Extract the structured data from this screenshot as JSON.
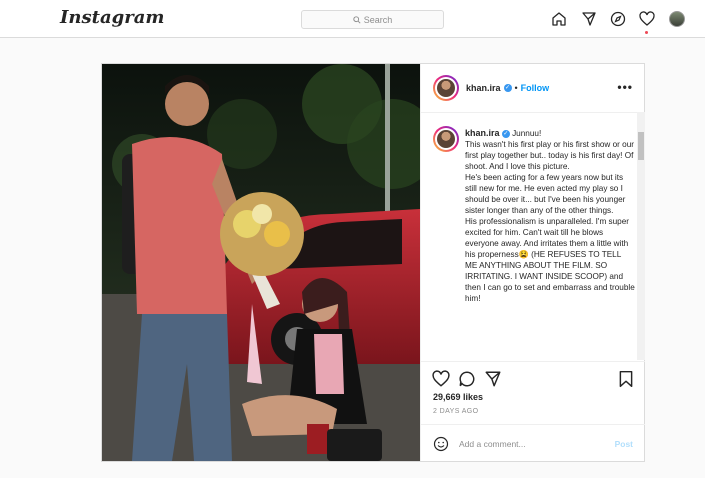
{
  "header": {
    "logo": "Instagram",
    "search_placeholder": "Search",
    "nav_icons": [
      "home-icon",
      "direct-icon",
      "explore-icon",
      "heart-icon",
      "profile-avatar"
    ]
  },
  "post": {
    "username": "khan.ira",
    "follow_label": "Follow",
    "more_label": "•••",
    "caption_user": "khan.ira",
    "caption_lines": [
      "Junnuu!",
      "This wasn't his first play or his first show or our first play together but.. today is his first day! Of shoot. And I love this picture.",
      "He's been acting for a few years now but its still new for me. He even acted my play so I should be over it... but I've been his younger sister longer than any of the other things.",
      "His professionalism is unparalleled. I'm super excited for him. Can't wait till he blows everyone away. And irritates them a little with his properness😫 (HE REFUSES TO TELL ME ANYTHING ABOUT THE FILM. SO IRRITATING. I WANT INSIDE SCOOP) and then I can go to set and embarrass and trouble him!"
    ],
    "likes": "29,669 likes",
    "timestamp": "2 DAYS AGO",
    "comment_placeholder": "Add a comment...",
    "post_label": "Post"
  },
  "colors": {
    "accent": "#0095f6",
    "notification_dot": "#ed4956",
    "border": "#dbdbdb"
  }
}
